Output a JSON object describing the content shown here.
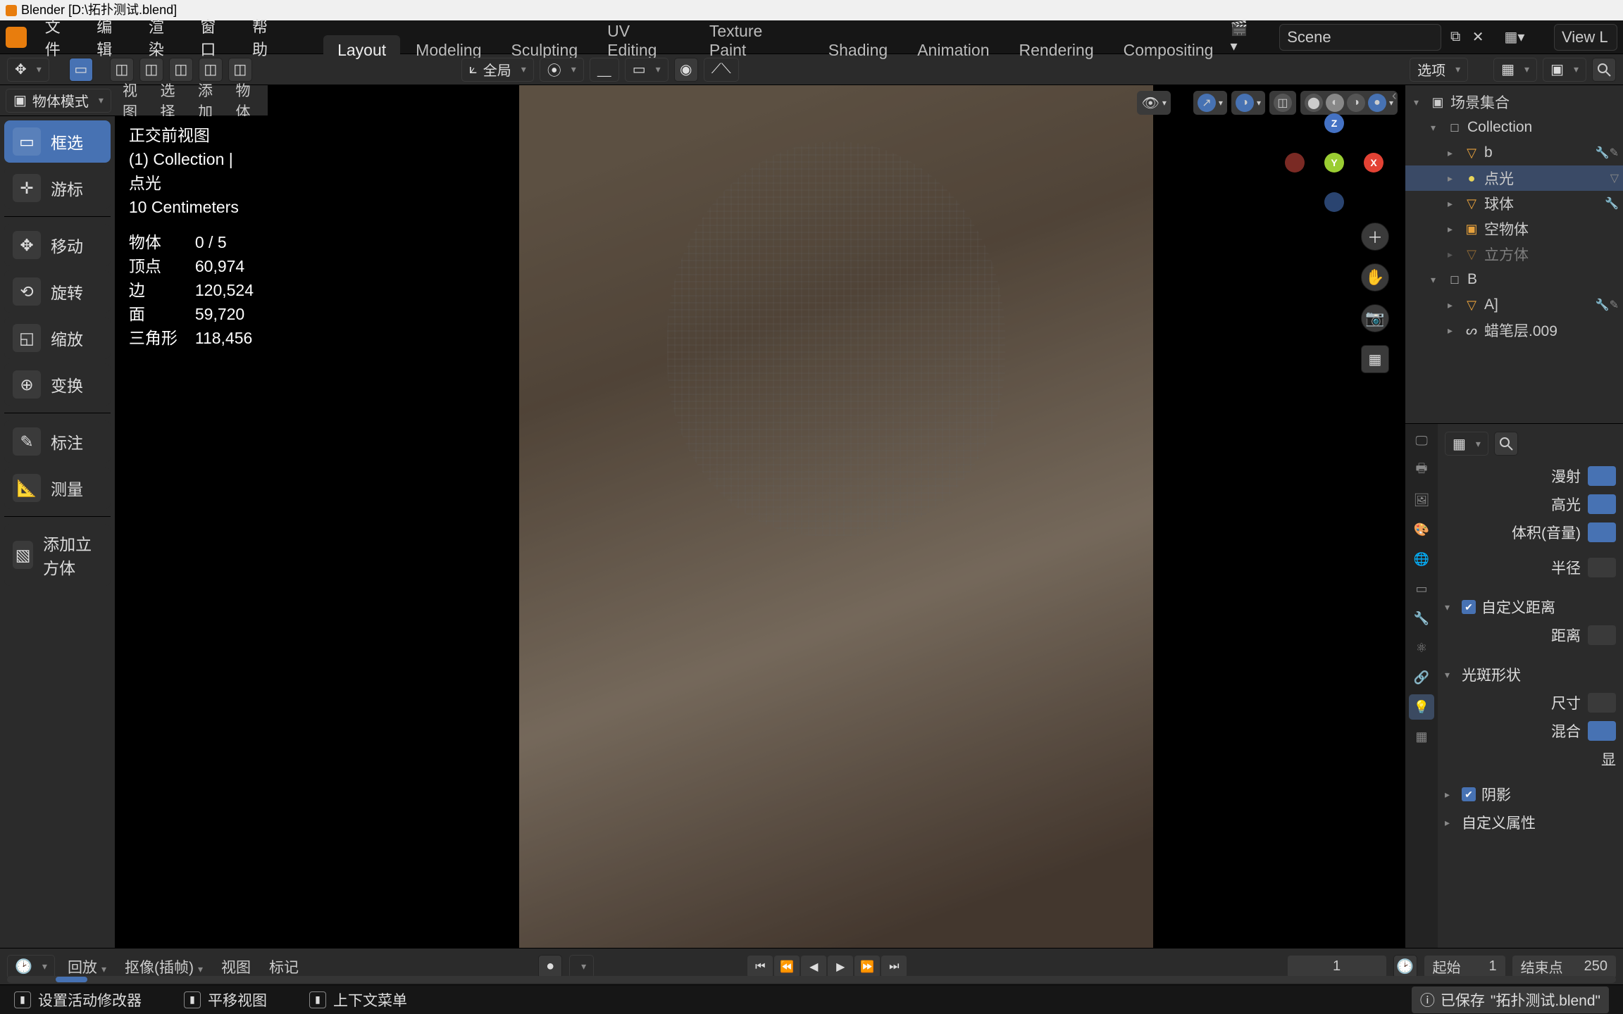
{
  "titlebar": "Blender [D:\\拓扑测试.blend]",
  "menu": {
    "file": "文件",
    "edit": "编辑",
    "render": "渲染",
    "window": "窗口",
    "help": "帮助"
  },
  "workspaces": [
    "Layout",
    "Modeling",
    "Sculpting",
    "UV Editing",
    "Texture Paint",
    "Shading",
    "Animation",
    "Rendering",
    "Compositing"
  ],
  "active_workspace": "Layout",
  "scene_label": "Scene",
  "viewlayer_label": "View L",
  "toolbar": {
    "global": "全局",
    "options": "选项"
  },
  "mode_selector": "物体模式",
  "header_menus": {
    "view": "视图",
    "select": "选择",
    "add": "添加",
    "object": "物体"
  },
  "left_tools": {
    "box": "框选",
    "cursor": "游标",
    "move": "移动",
    "rotate": "旋转",
    "scale": "缩放",
    "transform": "变换",
    "annotate": "标注",
    "measure": "测量",
    "add_cube": "添加立方体"
  },
  "viewport_info": {
    "projection": "正交前视图",
    "collection_line": "(1) Collection | 点光",
    "units": "10 Centimeters",
    "objects_label": "物体",
    "objects": "0 / 5",
    "verts_label": "顶点",
    "verts": "60,974",
    "edges_label": "边",
    "edges": "120,524",
    "faces_label": "面",
    "faces": "59,720",
    "tris_label": "三角形",
    "tris": "118,456"
  },
  "outliner_header": "场景集合",
  "outliner": [
    {
      "indent": 1,
      "disclose": "▾",
      "type": "collection",
      "icon": "□",
      "label": "Collection"
    },
    {
      "indent": 2,
      "disclose": "▸",
      "type": "mesh",
      "icon": "▽",
      "label": "b",
      "extra": "🔧✎"
    },
    {
      "indent": 2,
      "disclose": "▸",
      "type": "light",
      "icon": "●",
      "label": "点光",
      "extra": "▽",
      "selected": true
    },
    {
      "indent": 2,
      "disclose": "▸",
      "type": "mesh",
      "icon": "▽",
      "label": "球体",
      "extra": "🔧"
    },
    {
      "indent": 2,
      "disclose": "▸",
      "type": "empty",
      "icon": "▣",
      "label": "空物体"
    },
    {
      "indent": 2,
      "disclose": "▸",
      "type": "mesh",
      "icon": "▽",
      "label": "立方体",
      "dim": true
    },
    {
      "indent": 1,
      "disclose": "▾",
      "type": "collection",
      "icon": "□",
      "label": "B"
    },
    {
      "indent": 2,
      "disclose": "▸",
      "type": "mesh",
      "icon": "▽",
      "label": "A]",
      "extra": "🔧✎"
    },
    {
      "indent": 2,
      "disclose": "▸",
      "type": "gpencil",
      "icon": "ᔕ",
      "label": "蜡笔层.009"
    }
  ],
  "props": {
    "diffuse": "漫射",
    "specular": "高光",
    "volume": "体积(音量)",
    "radius": "半径",
    "custom_dist": "自定义距离",
    "distance": "距离",
    "spot": "光斑形状",
    "size": "尺寸",
    "blend": "混合",
    "show": "显",
    "shadow": "阴影",
    "custom_props": "自定义属性"
  },
  "timeline": {
    "playback": "回放",
    "keying": "抠像(插帧)",
    "view": "视图",
    "marker": "标记",
    "current": "1",
    "start_label": "起始",
    "start": "1",
    "end_label": "结束点",
    "end": "250"
  },
  "status": {
    "left": "设置活动修改器",
    "mid": "平移视图",
    "right": "上下文菜单",
    "info_prefix": "已保存",
    "info_file": "\"拓扑测试.blend\""
  }
}
